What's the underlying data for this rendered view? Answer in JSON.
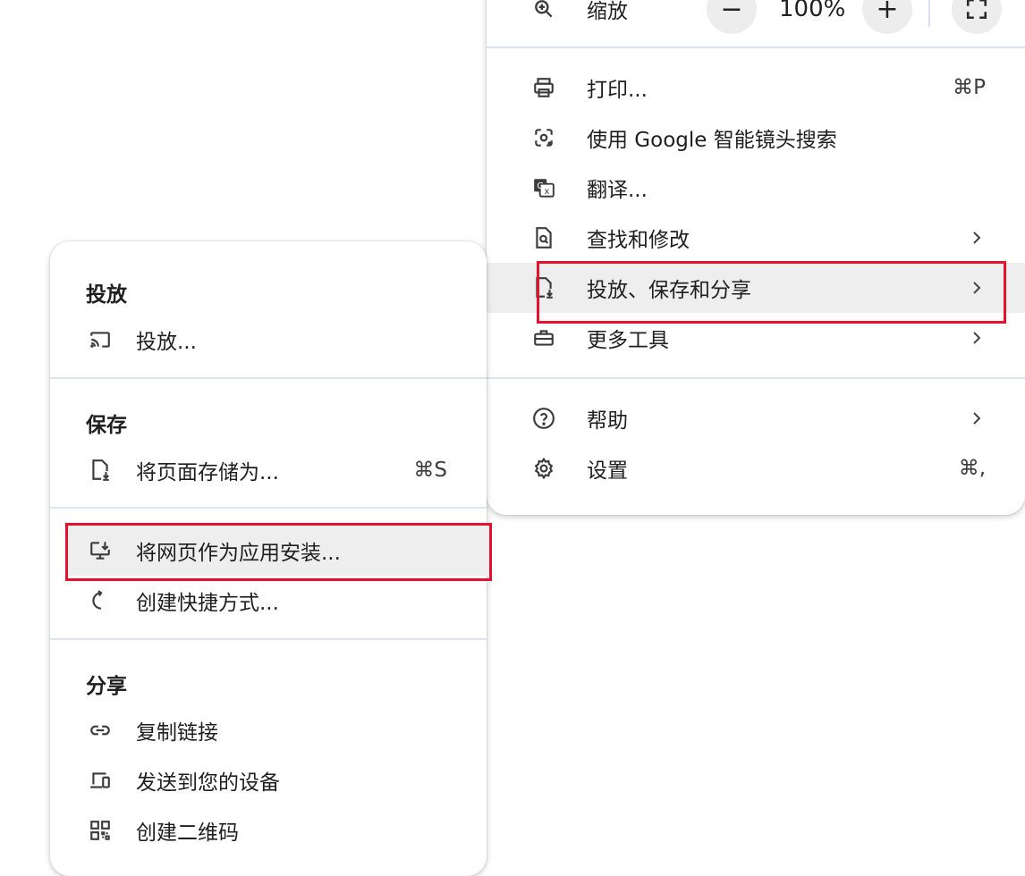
{
  "main_menu": {
    "zoom": {
      "label": "缩放",
      "minus": "−",
      "value": "100%",
      "plus": "+"
    },
    "items": [
      {
        "label": "打印...",
        "shortcut": "⌘P",
        "icon": "printer-icon"
      },
      {
        "label": "使用 Google 智能镜头搜索",
        "icon": "google-lens-icon"
      },
      {
        "label": "翻译...",
        "icon": "translate-icon"
      },
      {
        "label": "查找和修改",
        "icon": "find-icon",
        "has_submenu": true
      },
      {
        "label": "投放、保存和分享",
        "icon": "save-file-icon",
        "has_submenu": true,
        "highlighted": true
      },
      {
        "label": "更多工具",
        "icon": "toolbox-icon",
        "has_submenu": true
      },
      {
        "label": "帮助",
        "icon": "help-icon",
        "has_submenu": true
      },
      {
        "label": "设置",
        "shortcut": "⌘,",
        "icon": "gear-icon"
      }
    ]
  },
  "submenu": {
    "sections": [
      {
        "title": "投放",
        "items": [
          {
            "label": "投放...",
            "icon": "cast-icon"
          }
        ]
      },
      {
        "title": "保存",
        "items": [
          {
            "label": "将页面存储为...",
            "shortcut": "⌘S",
            "icon": "save-page-icon"
          }
        ]
      },
      {
        "title": "",
        "items": [
          {
            "label": "将网页作为应用安装...",
            "icon": "install-app-icon",
            "highlighted": true
          },
          {
            "label": "创建快捷方式...",
            "icon": "shortcut-icon"
          }
        ]
      },
      {
        "title": "分享",
        "items": [
          {
            "label": "复制链接",
            "icon": "link-icon"
          },
          {
            "label": "发送到您的设备",
            "icon": "devices-icon"
          },
          {
            "label": "创建二维码",
            "icon": "qr-code-icon"
          }
        ]
      }
    ]
  },
  "annotation_color": "#e5112d"
}
